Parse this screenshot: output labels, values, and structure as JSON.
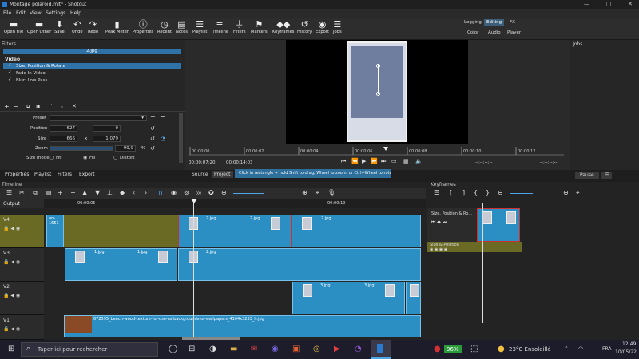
{
  "window": {
    "title": "Montage polaroid.mlt* - Shotcut",
    "min": "—",
    "max": "▢",
    "close": "✕"
  },
  "menu": [
    "File",
    "Edit",
    "View",
    "Settings",
    "Help"
  ],
  "toolbar": [
    {
      "label": "Open File",
      "icon": "folder-open-icon",
      "glyph": "▬"
    },
    {
      "label": "Open Other",
      "icon": "folder-icon",
      "glyph": "▬"
    },
    {
      "label": "Save",
      "icon": "save-icon",
      "glyph": "⬇"
    },
    {
      "label": "Undo",
      "icon": "undo-icon",
      "glyph": "↶"
    },
    {
      "label": "Redo",
      "icon": "redo-icon",
      "glyph": "↷"
    },
    {
      "label": "Peak Meter",
      "icon": "meter-icon",
      "glyph": "▮"
    },
    {
      "label": "Properties",
      "icon": "info-icon",
      "glyph": "ⓘ"
    },
    {
      "label": "Recent",
      "icon": "clock-icon",
      "glyph": "◷"
    },
    {
      "label": "Notes",
      "icon": "notes-icon",
      "glyph": "▤"
    },
    {
      "label": "Playlist",
      "icon": "playlist-icon",
      "glyph": "☰"
    },
    {
      "label": "Timeline",
      "icon": "timeline-icon",
      "glyph": "≡"
    },
    {
      "label": "Filters",
      "icon": "filter-icon",
      "glyph": "⏚"
    },
    {
      "label": "Markers",
      "icon": "marker-icon",
      "glyph": "⚑"
    },
    {
      "label": "Keyframes",
      "icon": "keyframes-icon",
      "glyph": "◆◆"
    },
    {
      "label": "History",
      "icon": "history-icon",
      "glyph": "↺"
    },
    {
      "label": "Export",
      "icon": "export-icon",
      "glyph": "◉"
    },
    {
      "label": "Jobs",
      "icon": "jobs-icon",
      "glyph": "☰"
    }
  ],
  "modes": {
    "top": [
      "Logging",
      "Editing",
      "FX"
    ],
    "bottom": [
      "Color",
      "Audio",
      "Player"
    ]
  },
  "filters": {
    "header": "Filters",
    "clip": "2.jpg",
    "video_label": "Video",
    "items": [
      "Size, Position & Rotate",
      "Fade In Video",
      "Blur: Low Pass"
    ],
    "preset_label": "Preset",
    "position_label": "Position",
    "pos_x": "627",
    "pos_y": "0",
    "size_label": "Size",
    "size_w": "666",
    "size_h": "1 079",
    "zoom_label": "Zoom",
    "zoom_val": "99,9",
    "zoom_unit": "%",
    "sizemode_label": "Size mode",
    "fit": "Fit",
    "fill": "Fill",
    "distort": "Distort",
    "sep1": ",",
    "sep2": "x"
  },
  "player": {
    "timecode": "00:00:07:20",
    "duration": "00:00:14:03",
    "ticks": [
      "00:00:00",
      "00:00:02",
      "00:00:04",
      "00:00:06",
      "00:00:08",
      "00:00:10",
      "00:00:12"
    ],
    "end1": "--:--:--:--",
    "end2": "--:--:--:--",
    "source": "Source",
    "project": "Project",
    "hint": "Click in rectangle + hold Shift to drag, Wheel to zoom, or Ctrl+Wheel to rotate"
  },
  "jobs": {
    "header": "Jobs",
    "pause": "Pause"
  },
  "tabs": [
    "Properties",
    "Playlist",
    "Filters",
    "Export"
  ],
  "timeline": {
    "header": "Timeline",
    "output": "Output",
    "ruler": [
      "00:00:05",
      "00:00:10"
    ],
    "tracks": [
      "V4",
      "V3",
      "V2",
      "V1"
    ],
    "clips": {
      "v4a": "oo-1651",
      "v4b": "2.jpg",
      "v4c": "2.jpg",
      "v4d": "2.jpg",
      "v3a": "1.jpg",
      "v3b": "1.jpg",
      "v3c": "2.jpg",
      "v2a": "3.jpg",
      "v2b": "3.jpg",
      "v1": "672595_beech-wood-texture-for-use-as-backgrounds-or-wallpapers_4104x3233_h.jpg"
    }
  },
  "keyframes": {
    "header": "Keyframes",
    "param": "Size, Position & Ro...",
    "filter": "Size & Position"
  },
  "taskbar": {
    "search": "Taper ici pour rechercher",
    "battery": "96%",
    "temp": "23°C Ensoleillé",
    "lang": "FRA",
    "time": "12:49",
    "date": "10/05/22"
  }
}
